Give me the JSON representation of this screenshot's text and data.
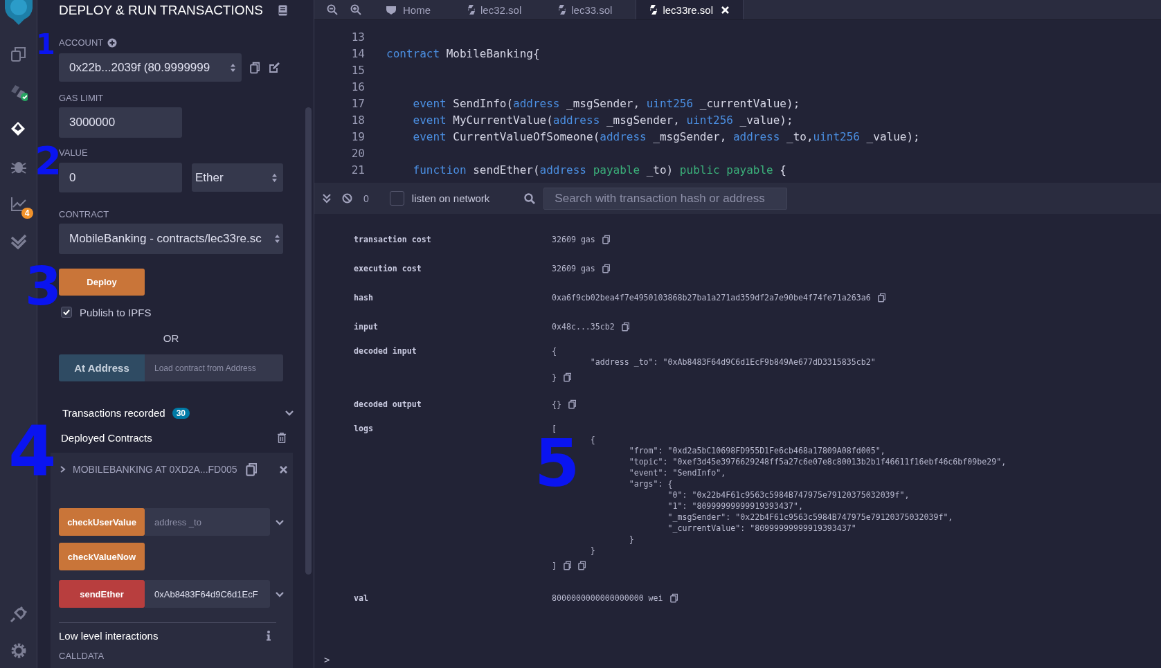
{
  "icon_bar": {
    "items": [
      {
        "kind": "files",
        "selected": false
      },
      {
        "kind": "compiler",
        "selected": false
      },
      {
        "kind": "deploy",
        "selected": true
      },
      {
        "kind": "debugger",
        "selected": false
      },
      {
        "kind": "analysis",
        "selected": false,
        "badge": "4"
      },
      {
        "kind": "tests",
        "selected": false
      }
    ],
    "bottom": [
      {
        "kind": "plugins"
      },
      {
        "kind": "settings"
      }
    ]
  },
  "side_panel": {
    "title": "DEPLOY & RUN TRANSACTIONS",
    "account": {
      "label": "ACCOUNT",
      "value": "0x22b...2039f (80.9999999"
    },
    "gas_limit": {
      "label": "GAS LIMIT",
      "value": "3000000"
    },
    "value": {
      "label": "VALUE",
      "amount": "0",
      "unit": "Ether"
    },
    "contract": {
      "label": "CONTRACT",
      "value": "MobileBanking - contracts/lec33re.sc"
    },
    "deploy_button": "Deploy",
    "publish": {
      "label": "Publish to IPFS",
      "checked": true
    },
    "or": "OR",
    "at_address": {
      "button": "At Address",
      "placeholder": "Load contract from Address"
    },
    "transactions": {
      "label": "Transactions recorded",
      "count": "30"
    },
    "deployed": {
      "label": "Deployed Contracts",
      "instance": {
        "title": "MOBILEBANKING AT 0XD2A...FD005",
        "functions": [
          {
            "name": "checkUserValue",
            "kind": "call",
            "placeholder": "address _to"
          },
          {
            "name": "checkValueNow",
            "kind": "call"
          },
          {
            "name": "sendEther",
            "kind": "payable",
            "value": "0xAb8483F64d9C6d1EcF"
          }
        ],
        "low_level": "Low level interactions",
        "calldata_label": "CALLDATA"
      }
    }
  },
  "editor": {
    "tabs": [
      {
        "label": "Home",
        "kind": "home",
        "selected": false
      },
      {
        "label": "lec32.sol",
        "kind": "file",
        "selected": false
      },
      {
        "label": "lec33.sol",
        "kind": "file",
        "selected": false
      },
      {
        "label": "lec33re.sol",
        "kind": "file",
        "selected": true
      }
    ],
    "lines": [
      {
        "number": "13"
      },
      {
        "number": "14",
        "tokens": [
          {
            "text": "contract",
            "kind": "keyword"
          },
          {
            "text": " MobileBanking{",
            "kind": "plain"
          }
        ]
      },
      {
        "number": "15"
      },
      {
        "number": "16"
      },
      {
        "number": "17",
        "tokens": [
          {
            "text": "    event",
            "kind": "keyword"
          },
          {
            "text": " SendInfo(",
            "kind": "plain"
          },
          {
            "text": "address",
            "kind": "keyword"
          },
          {
            "text": " _msgSender, ",
            "kind": "plain"
          },
          {
            "text": "uint256",
            "kind": "keyword"
          },
          {
            "text": " _currentValue);",
            "kind": "plain"
          }
        ]
      },
      {
        "number": "18",
        "tokens": [
          {
            "text": "    event",
            "kind": "keyword"
          },
          {
            "text": " MyCurrentValue(",
            "kind": "plain"
          },
          {
            "text": "address",
            "kind": "keyword"
          },
          {
            "text": " _msgSender, ",
            "kind": "plain"
          },
          {
            "text": "uint256",
            "kind": "keyword"
          },
          {
            "text": " _value);",
            "kind": "plain"
          }
        ]
      },
      {
        "number": "19",
        "tokens": [
          {
            "text": "    event",
            "kind": "keyword"
          },
          {
            "text": " CurrentValueOfSomeone(",
            "kind": "plain"
          },
          {
            "text": "address",
            "kind": "keyword"
          },
          {
            "text": " _msgSender, ",
            "kind": "plain"
          },
          {
            "text": "address",
            "kind": "keyword"
          },
          {
            "text": " _to,",
            "kind": "plain"
          },
          {
            "text": "uint256",
            "kind": "keyword"
          },
          {
            "text": " _value);",
            "kind": "plain"
          }
        ]
      },
      {
        "number": "20"
      },
      {
        "number": "21",
        "tokens": [
          {
            "text": "    function",
            "kind": "keyword"
          },
          {
            "text": " sendEther(",
            "kind": "plain"
          },
          {
            "text": "address ",
            "kind": "keyword"
          },
          {
            "text": "payable",
            "kind": "modifier"
          },
          {
            "text": " _to) ",
            "kind": "plain"
          },
          {
            "text": "public payable",
            "kind": "modifier"
          },
          {
            "text": " {",
            "kind": "plain"
          }
        ]
      }
    ]
  },
  "terminal": {
    "pending": "0",
    "listen": {
      "label": "listen on network",
      "checked": false
    },
    "search_placeholder": "Search with transaction hash or address",
    "rows": [
      {
        "key": "transaction cost",
        "value": "32609 gas",
        "kind": "plain"
      },
      {
        "key": "execution cost",
        "value": "32609 gas",
        "kind": "plain"
      },
      {
        "key": "hash",
        "value": "0xa6f9cb02bea4f7e4950103868b27ba1a271ad359df2a7e90be4f74fe71a263a6",
        "kind": "plain"
      },
      {
        "key": "input",
        "value": "0x48c...35cb2",
        "kind": "plain"
      },
      {
        "key": "decoded input",
        "value": "{\n        \"address _to\": \"0xAb8483F64d9C6d1EcF9b849Ae677dD3315835cb2\"\n}",
        "kind": "block"
      },
      {
        "key": "decoded output",
        "value": "{}",
        "kind": "plain"
      },
      {
        "key": "logs",
        "value": "[\n        {\n                \"from\": \"0xd2a5bC10698FD955D1Fe6cb468a17809A08fd005\",\n                \"topic\": \"0xef3d45e3976629248ff5a27c6e07e8c80013b2b1f46611f16ebf46c6bf09be29\",\n                \"event\": \"SendInfo\",\n                \"args\": {\n                        \"0\": \"0x22b4F61c9563c5984B747975e79120375032039f\",\n                        \"1\": \"80999999999919393437\",\n                        \"_msgSender\": \"0x22b4F61c9563c5984B747975e79120375032039f\",\n                        \"_currentValue\": \"80999999999919393437\"\n                }\n        }\n]",
        "kind": "logs"
      },
      {
        "key": "val",
        "value": "8000000000000000000 wei",
        "kind": "plain"
      }
    ],
    "prompt": ">"
  },
  "annotations": [
    {
      "text": "1"
    },
    {
      "text": "2"
    },
    {
      "text": "3"
    },
    {
      "text": "4"
    },
    {
      "text": "5"
    }
  ]
}
